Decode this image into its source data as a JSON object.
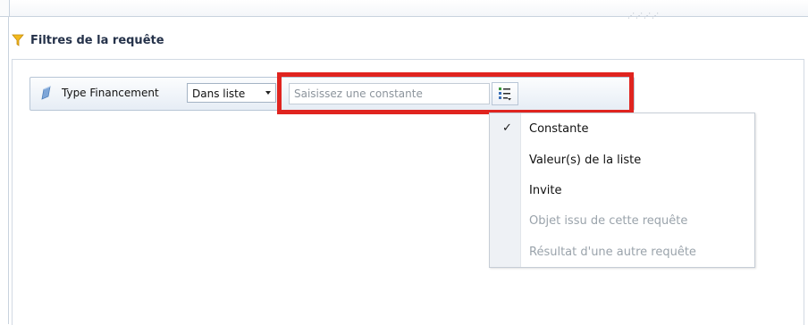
{
  "panel": {
    "title": "Filtres de la requête"
  },
  "filter": {
    "field_label": "Type Financement",
    "operator_value": "Dans liste",
    "value_placeholder": "Saisissez une constante"
  },
  "menu": {
    "items": [
      {
        "label": "Constante",
        "checked": true,
        "enabled": true
      },
      {
        "label": "Valeur(s) de la liste",
        "checked": false,
        "enabled": true
      },
      {
        "label": "Invite",
        "checked": false,
        "enabled": true
      },
      {
        "label": "Objet issu de cette requête",
        "checked": false,
        "enabled": false
      },
      {
        "label": "Résultat d'une autre requête",
        "checked": false,
        "enabled": false
      }
    ],
    "check_glyph": "✓"
  },
  "colors": {
    "highlight": "#e0241f",
    "funnel": "#f2b91e",
    "title_text": "#25324a",
    "disabled_text": "#9aa3ab"
  },
  "icons": {
    "panel": "funnel-icon",
    "field": "dimension-icon",
    "mode_button": "list-mode-icon"
  }
}
